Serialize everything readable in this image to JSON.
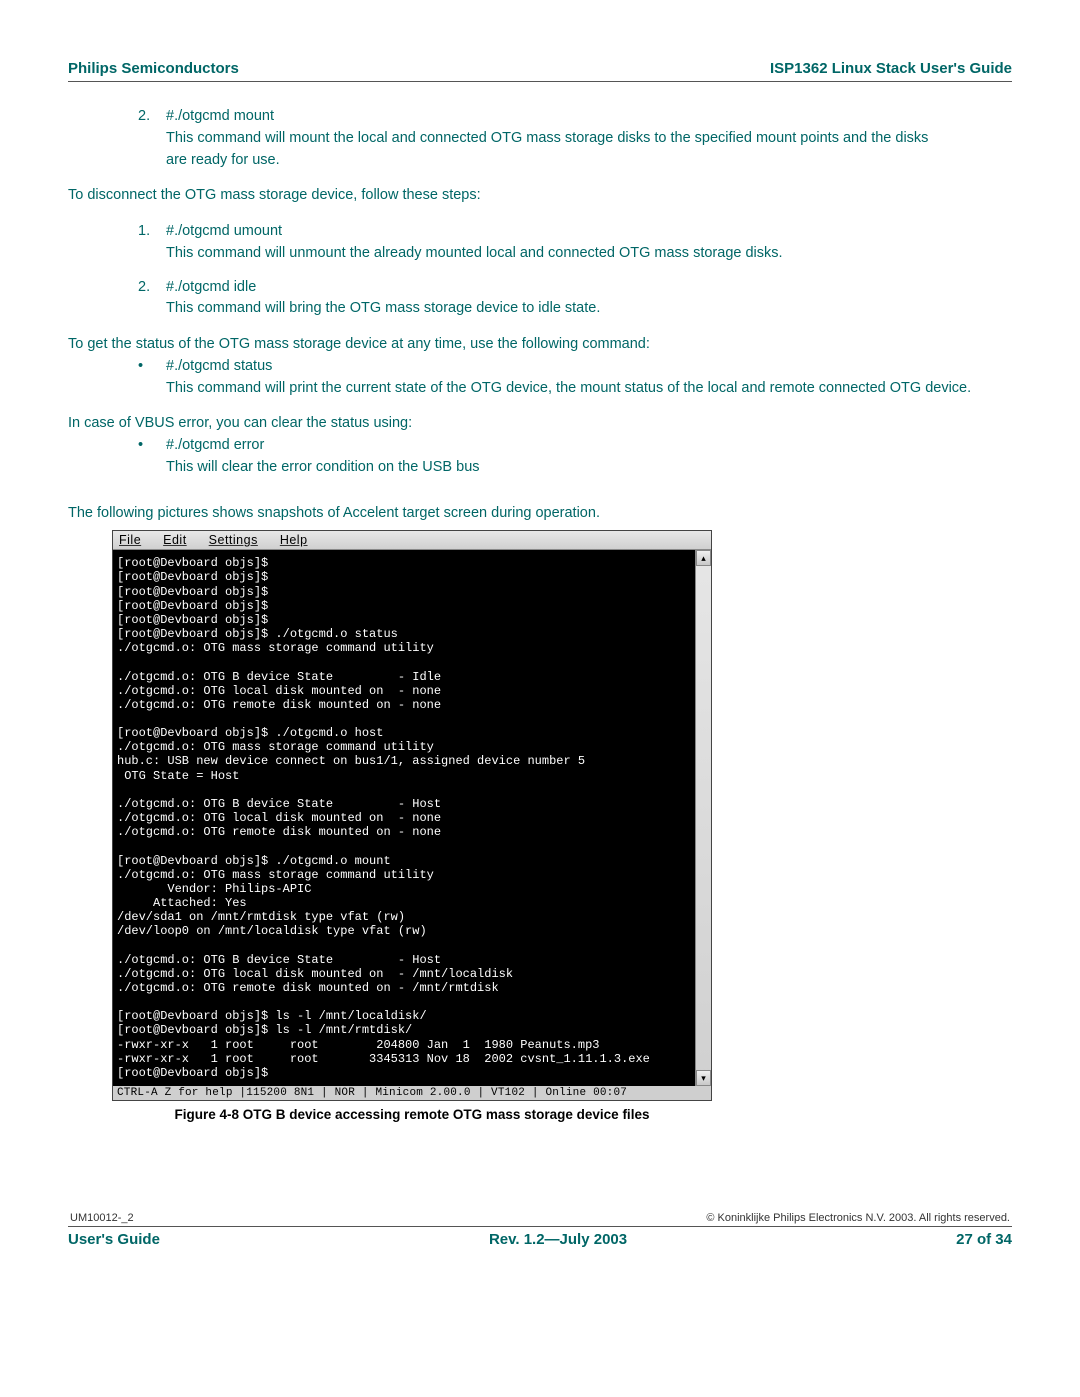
{
  "header": {
    "left": "Philips Semiconductors",
    "right": "ISP1362 Linux Stack User's Guide"
  },
  "s1": {
    "num": "2.",
    "cmd": "#./otgcmd mount",
    "desc": "This command will mount the local and connected OTG mass storage disks to the specified mount points and the disks are ready for use."
  },
  "p_disconnect": "To disconnect the OTG mass storage device, follow these steps:",
  "s2": {
    "num": "1.",
    "cmd": "#./otgcmd umount",
    "desc": "This command will unmount the already mounted local and connected OTG mass storage disks."
  },
  "s3": {
    "num": "2.",
    "cmd": "#./otgcmd idle",
    "desc": "This command will bring the OTG mass storage device to idle state."
  },
  "p_status": "To get the status of the OTG mass storage device at any time, use the following command:",
  "b1": {
    "cmd": "#./otgcmd status",
    "desc": "This command will print the current state of the OTG device, the mount status of the local and remote connected OTG device."
  },
  "p_vbus": "In case of VBUS error, you can clear the status using:",
  "b2": {
    "cmd": "#./otgcmd error",
    "desc": "This will clear the error condition on the USB bus"
  },
  "p_fig": "The following pictures shows snapshots of Accelent target screen during operation.",
  "term": {
    "menu": {
      "file": "File",
      "edit": "Edit",
      "settings": "Settings",
      "help": "Help"
    },
    "body": "[root@Devboard objs]$\n[root@Devboard objs]$\n[root@Devboard objs]$\n[root@Devboard objs]$\n[root@Devboard objs]$\n[root@Devboard objs]$ ./otgcmd.o status\n./otgcmd.o: OTG mass storage command utility\n\n./otgcmd.o: OTG B device State         - Idle\n./otgcmd.o: OTG local disk mounted on  - none\n./otgcmd.o: OTG remote disk mounted on - none\n\n[root@Devboard objs]$ ./otgcmd.o host\n./otgcmd.o: OTG mass storage command utility\nhub.c: USB new device connect on bus1/1, assigned device number 5\n OTG State = Host\n\n./otgcmd.o: OTG B device State         - Host\n./otgcmd.o: OTG local disk mounted on  - none\n./otgcmd.o: OTG remote disk mounted on - none\n\n[root@Devboard objs]$ ./otgcmd.o mount\n./otgcmd.o: OTG mass storage command utility\n       Vendor: Philips-APIC\n     Attached: Yes\n/dev/sda1 on /mnt/rmtdisk type vfat (rw)\n/dev/loop0 on /mnt/localdisk type vfat (rw)\n\n./otgcmd.o: OTG B device State         - Host\n./otgcmd.o: OTG local disk mounted on  - /mnt/localdisk\n./otgcmd.o: OTG remote disk mounted on - /mnt/rmtdisk\n\n[root@Devboard objs]$ ls -l /mnt/localdisk/\n[root@Devboard objs]$ ls -l /mnt/rmtdisk/\n-rwxr-xr-x   1 root     root        204800 Jan  1  1980 Peanuts.mp3\n-rwxr-xr-x   1 root     root       3345313 Nov 18  2002 cvsnt_1.11.1.3.exe\n[root@Devboard objs]$ ",
    "status": " CTRL-A Z for help |115200 8N1 | NOR | Minicom 2.00.0 | VT102 | Online 00:07"
  },
  "caption": "Figure 4-8 OTG B device accessing remote OTG mass storage device files",
  "footer": {
    "docnum": "UM10012-_2",
    "copyright": "© Koninklijke Philips Electronics N.V. 2003. All rights reserved.",
    "left": "User's Guide",
    "center": "Rev. 1.2—July 2003",
    "right": "27 of 34"
  }
}
